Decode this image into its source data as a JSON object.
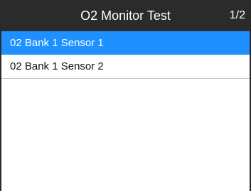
{
  "header": {
    "title": "O2 Monitor Test",
    "page_indicator": "1/2"
  },
  "list": {
    "items": [
      {
        "label": "02 Bank 1 Sensor 1",
        "selected": true
      },
      {
        "label": "02 Bank 1 Sensor 2",
        "selected": false
      }
    ]
  },
  "colors": {
    "header_bg": "#2b2b2b",
    "selection_bg": "#1e90ff"
  }
}
